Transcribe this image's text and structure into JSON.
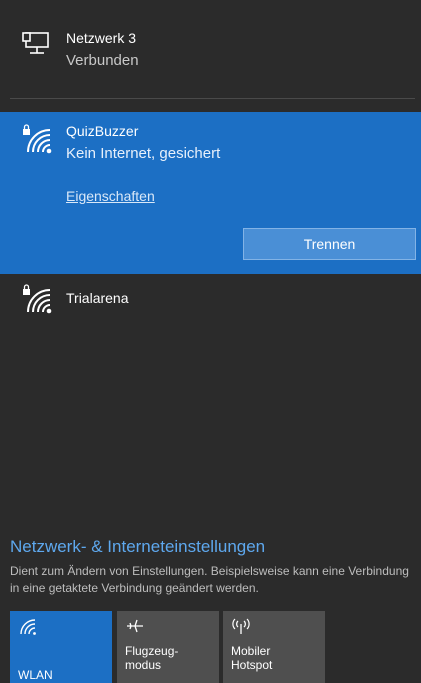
{
  "wired": {
    "name": "Netzwerk 3",
    "status": "Verbunden",
    "icon": "ethernet-icon"
  },
  "wifi_connected": {
    "name": "QuizBuzzer",
    "status": "Kein Internet, gesichert",
    "properties_link": "Eigenschaften",
    "disconnect_label": "Trennen",
    "icon": "wifi-secured-icon"
  },
  "wifi_networks": [
    {
      "name": "Trialarena",
      "icon": "wifi-secured-icon"
    }
  ],
  "settings": {
    "title": "Netzwerk- & Interneteinstellungen",
    "description": "Dient zum Ändern von Einstellungen. Beispielsweise kann eine Verbindung in eine getaktete Verbindung geändert werden."
  },
  "quick_actions": {
    "wlan": "WLAN",
    "airplane_line1": "Flugzeug-",
    "airplane_line2": "modus",
    "hotspot_line1": "Mobiler",
    "hotspot_line2": "Hotspot"
  },
  "colors": {
    "accent": "#1c6fc4",
    "background": "#2b2b2b",
    "link": "#5ea8ee",
    "tile_off": "#4f4f4f"
  }
}
